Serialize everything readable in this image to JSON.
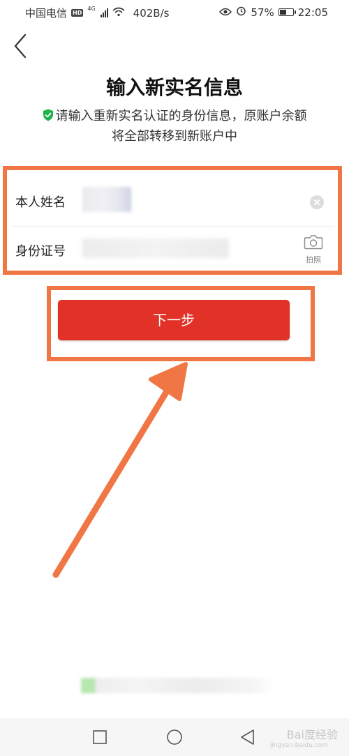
{
  "status_bar": {
    "carrier": "中国电信",
    "hd": "HD",
    "net_type": "4G",
    "speed": "402B/s",
    "battery": "57%",
    "battery_level": 0.57,
    "time": "22:05"
  },
  "page": {
    "title": "输入新实名信息",
    "subtitle_line1": "请输入重新实名认证的身份信息，原账户余额",
    "subtitle_line2": "将全部转移到新账户中"
  },
  "form": {
    "name_label": "本人姓名",
    "name_value": "刘",
    "id_label": "身份证号",
    "id_placeholder": "请",
    "camera_label": "拍照"
  },
  "next_button_label": "下一步",
  "colors": {
    "primary_button": "#e23127",
    "annotation": "#f07745",
    "shield": "#1eb24b"
  },
  "icons": {
    "back": "chevron-left-icon",
    "clear": "clear-icon",
    "camera": "camera-icon",
    "shield": "shield-check-icon",
    "wifi": "wifi-icon",
    "eye": "eye-icon",
    "alarm": "alarm-icon"
  },
  "watermark": {
    "text": "Bai度经验",
    "sub": "jingyan.baidu.com"
  }
}
